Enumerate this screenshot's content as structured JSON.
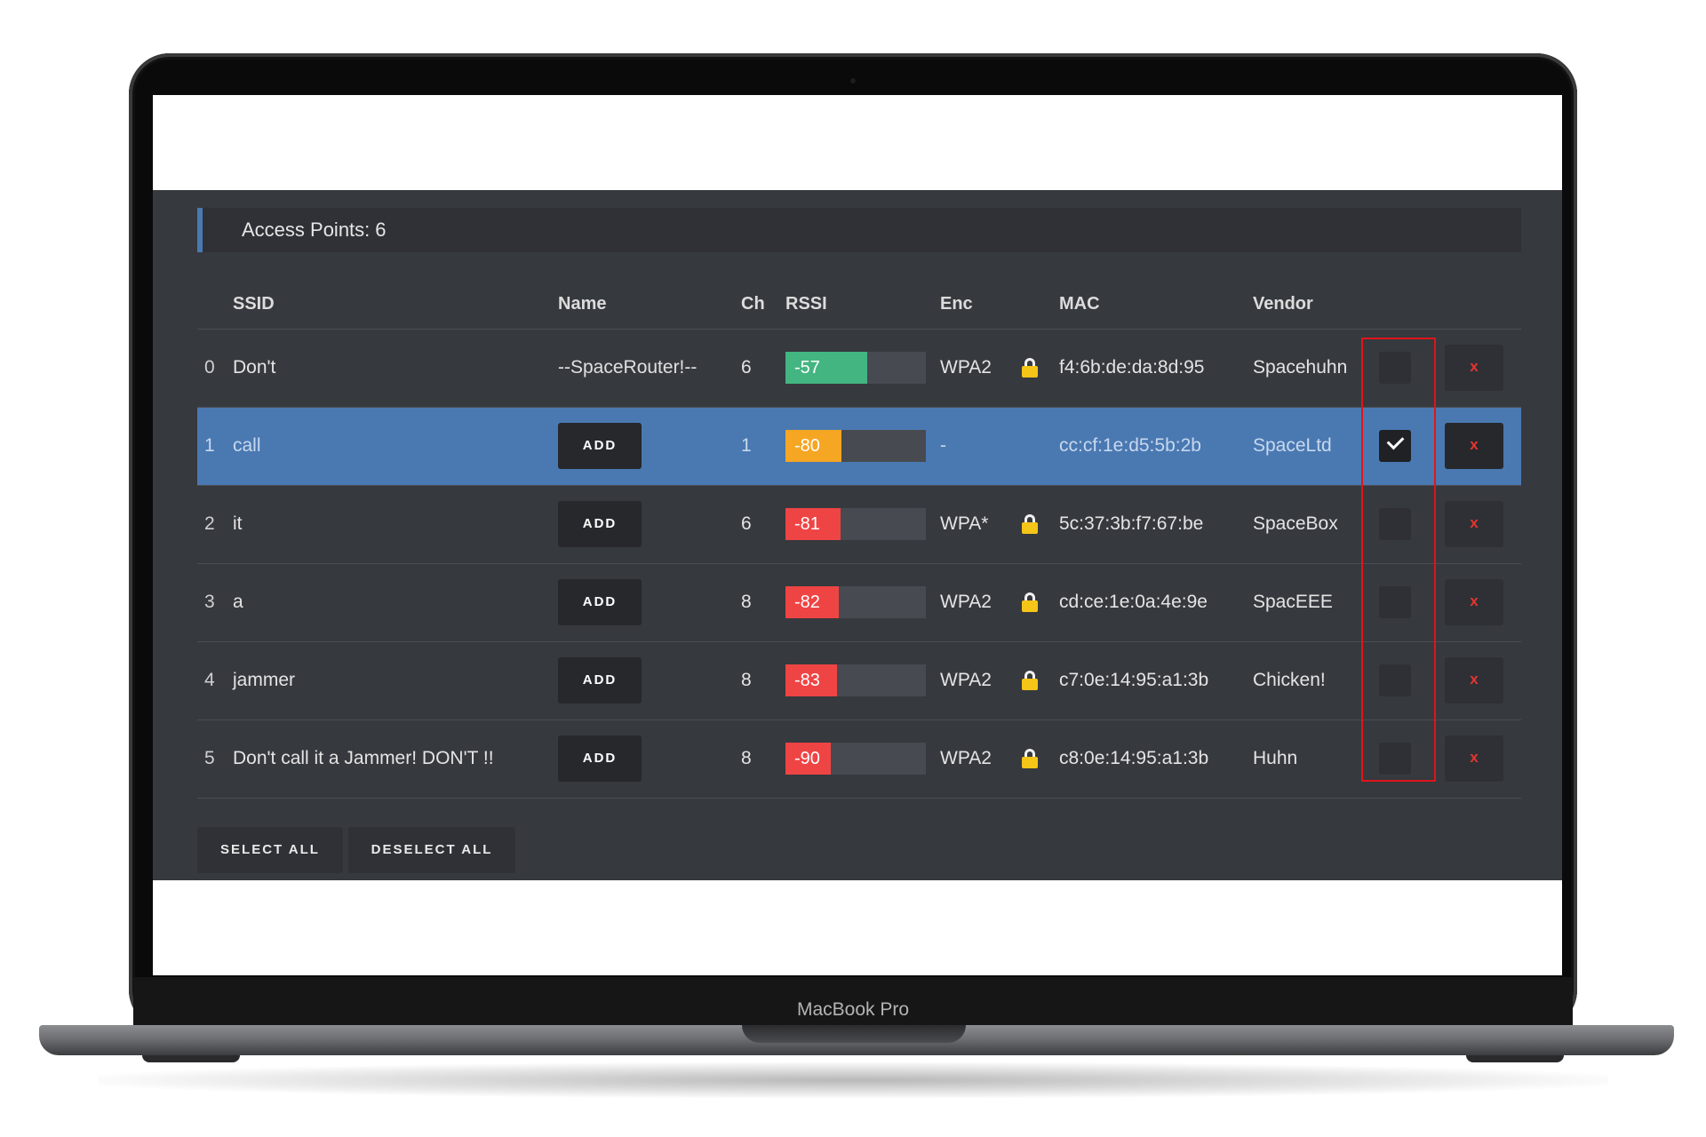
{
  "device": {
    "brand_label": "MacBook Pro"
  },
  "panel": {
    "header_label": "Access Points:",
    "ap_count": "6",
    "columns": [
      "SSID",
      "Name",
      "Ch",
      "RSSI",
      "Enc",
      "MAC",
      "Vendor"
    ],
    "rows": [
      {
        "index": "0",
        "ssid": "Don't",
        "name": "--SpaceRouter!--",
        "add_label": "",
        "ch": "6",
        "rssi": "-57",
        "rssi_fill_pct": 58,
        "rssi_color": "#43b581",
        "enc": "WPA2",
        "locked": true,
        "mac": "f4:6b:de:da:8d:95",
        "vendor": "Spacehuhn",
        "selected": false,
        "delete_label": "x"
      },
      {
        "index": "1",
        "ssid": "call",
        "name": "",
        "add_label": "ADD",
        "ch": "1",
        "rssi": "-80",
        "rssi_fill_pct": 40,
        "rssi_color": "#f5a623",
        "enc": "-",
        "locked": false,
        "mac": "cc:cf:1e:d5:5b:2b",
        "vendor": "SpaceLtd",
        "selected": true,
        "delete_label": "x"
      },
      {
        "index": "2",
        "ssid": "it",
        "name": "",
        "add_label": "ADD",
        "ch": "6",
        "rssi": "-81",
        "rssi_fill_pct": 39,
        "rssi_color": "#ef4444",
        "enc": "WPA*",
        "locked": true,
        "mac": "5c:37:3b:f7:67:be",
        "vendor": "SpaceBox",
        "selected": false,
        "delete_label": "x"
      },
      {
        "index": "3",
        "ssid": "a",
        "name": "",
        "add_label": "ADD",
        "ch": "8",
        "rssi": "-82",
        "rssi_fill_pct": 38,
        "rssi_color": "#ef4444",
        "enc": "WPA2",
        "locked": true,
        "mac": "cd:ce:1e:0a:4e:9e",
        "vendor": "SpacEEE",
        "selected": false,
        "delete_label": "x"
      },
      {
        "index": "4",
        "ssid": "jammer",
        "name": "",
        "add_label": "ADD",
        "ch": "8",
        "rssi": "-83",
        "rssi_fill_pct": 37,
        "rssi_color": "#ef4444",
        "enc": "WPA2",
        "locked": true,
        "mac": "c7:0e:14:95:a1:3b",
        "vendor": "Chicken!",
        "selected": false,
        "delete_label": "x"
      },
      {
        "index": "5",
        "ssid": "Don't call it a Jammer! DON'T !!",
        "name": "",
        "add_label": "ADD",
        "ch": "8",
        "rssi": "-90",
        "rssi_fill_pct": 32,
        "rssi_color": "#ef4444",
        "enc": "WPA2",
        "locked": true,
        "mac": "c8:0e:14:95:a1:3b",
        "vendor": "Huhn",
        "selected": false,
        "delete_label": "x"
      }
    ],
    "select_all_label": "SELECT ALL",
    "deselect_all_label": "DESELECT ALL"
  },
  "icons": {
    "lock": "lock-icon",
    "check": "checkmark-icon"
  },
  "colors": {
    "panel_bg": "#36393e",
    "header_bg": "#2f3136",
    "selected_row": "#4a79b2",
    "accent": "#4a79b2",
    "delete_red": "#e8342f",
    "highlight_red": "#e0141b"
  }
}
